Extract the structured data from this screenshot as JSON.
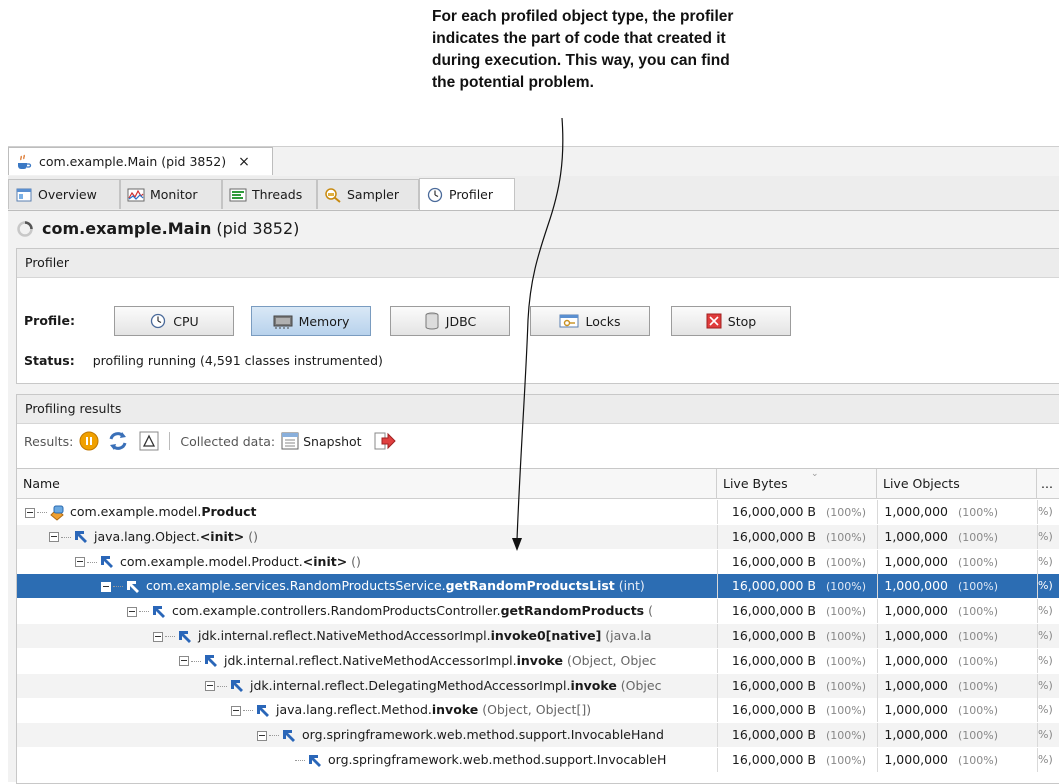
{
  "annotation": {
    "lines": [
      "For each profiled object type, the profiler",
      "indicates the part of code that created it",
      "during execution. This way, you can find",
      "the potential problem."
    ]
  },
  "window": {
    "doc_tab_label": "com.example.Main (pid 3852)",
    "close_symbol": "×",
    "tabs": [
      {
        "label": "Overview",
        "icon": "overview-icon"
      },
      {
        "label": "Monitor",
        "icon": "monitor-icon"
      },
      {
        "label": "Threads",
        "icon": "threads-icon"
      },
      {
        "label": "Sampler",
        "icon": "sampler-icon"
      },
      {
        "label": "Profiler",
        "icon": "profiler-icon",
        "active": true
      }
    ],
    "app_title_bold": "com.example.Main",
    "app_title_pid": "(pid 3852)"
  },
  "profiler_panel": {
    "header": "Profiler",
    "profile_label": "Profile:",
    "buttons": [
      {
        "label": "CPU",
        "icon": "clock-icon"
      },
      {
        "label": "Memory",
        "icon": "memory-icon",
        "selected": true
      },
      {
        "label": "JDBC",
        "icon": "database-icon"
      },
      {
        "label": "Locks",
        "icon": "lock-icon"
      },
      {
        "label": "Stop",
        "icon": "stop-icon"
      }
    ],
    "status_label": "Status:",
    "status_value": "profiling running (4,591 classes instrumented)"
  },
  "results_panel": {
    "header": "Profiling results",
    "results_label": "Results:",
    "collected_label": "Collected data:",
    "snapshot_label": "Snapshot"
  },
  "table": {
    "columns": {
      "name": "Name",
      "live_bytes": "Live Bytes",
      "live_objects": "Live Objects",
      "more": "..."
    },
    "rows": [
      {
        "prefix": "com.example.model.",
        "method": "Product",
        "args": "",
        "bytes": "16,000,000 B",
        "bytes_pct": "(100%)",
        "objects": "1,000,000",
        "objects_pct": "(100%)",
        "tail": "%)"
      },
      {
        "prefix": "java.lang.Object.",
        "method": "<init>",
        "args": " ()",
        "bytes": "16,000,000 B",
        "bytes_pct": "(100%)",
        "objects": "1,000,000",
        "objects_pct": "(100%)",
        "tail": "%)"
      },
      {
        "prefix": "com.example.model.Product.",
        "method": "<init>",
        "args": " ()",
        "bytes": "16,000,000 B",
        "bytes_pct": "(100%)",
        "objects": "1,000,000",
        "objects_pct": "(100%)",
        "tail": "%)"
      },
      {
        "prefix": "com.example.services.RandomProductsService.",
        "method": "getRandomProductsList",
        "args": " (int)",
        "bytes": "16,000,000 B",
        "bytes_pct": "(100%)",
        "objects": "1,000,000",
        "objects_pct": "(100%)",
        "tail": "%)"
      },
      {
        "prefix": "com.example.controllers.RandomProductsController.",
        "method": "getRandomProducts",
        "args": " (",
        "bytes": "16,000,000 B",
        "bytes_pct": "(100%)",
        "objects": "1,000,000",
        "objects_pct": "(100%)",
        "tail": "%)"
      },
      {
        "prefix": "jdk.internal.reflect.NativeMethodAccessorImpl.",
        "method": "invoke0[native]",
        "args": " (java.la",
        "bytes": "16,000,000 B",
        "bytes_pct": "(100%)",
        "objects": "1,000,000",
        "objects_pct": "(100%)",
        "tail": "%)"
      },
      {
        "prefix": "jdk.internal.reflect.NativeMethodAccessorImpl.",
        "method": "invoke",
        "args": " (Object, Objec",
        "bytes": "16,000,000 B",
        "bytes_pct": "(100%)",
        "objects": "1,000,000",
        "objects_pct": "(100%)",
        "tail": "%)"
      },
      {
        "prefix": "jdk.internal.reflect.DelegatingMethodAccessorImpl.",
        "method": "invoke",
        "args": " (Objec",
        "bytes": "16,000,000 B",
        "bytes_pct": "(100%)",
        "objects": "1,000,000",
        "objects_pct": "(100%)",
        "tail": "%)"
      },
      {
        "prefix": "java.lang.reflect.Method.",
        "method": "invoke",
        "args": " (Object, Object[])",
        "bytes": "16,000,000 B",
        "bytes_pct": "(100%)",
        "objects": "1,000,000",
        "objects_pct": "(100%)",
        "tail": "%)"
      },
      {
        "prefix": "org.springframework.web.method.support.InvocableHand",
        "method": "",
        "args": "",
        "bytes": "16,000,000 B",
        "bytes_pct": "(100%)",
        "objects": "1,000,000",
        "objects_pct": "(100%)",
        "tail": "%)"
      },
      {
        "prefix": "org.springframework.web.method.support.InvocableH",
        "method": "",
        "args": "",
        "bytes": "16,000,000 B",
        "bytes_pct": "(100%)",
        "objects": "1,000,000",
        "objects_pct": "(100%)",
        "tail": "%)"
      }
    ]
  },
  "colors": {
    "selection": "#2c6db3",
    "accent_blue": "#2c6db3",
    "stop_red": "#e03c3c",
    "pause_orange": "#f0a000"
  }
}
